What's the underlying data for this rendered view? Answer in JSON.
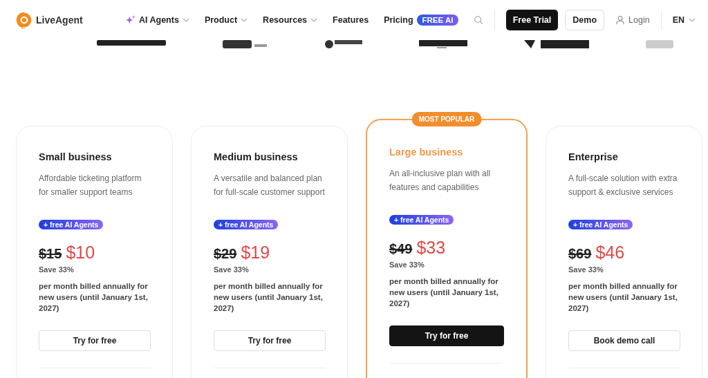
{
  "header": {
    "brand": "LiveAgent",
    "nav": [
      {
        "label": "AI Agents",
        "sparkle": true,
        "dropdown": true
      },
      {
        "label": "Product",
        "sparkle": false,
        "dropdown": true
      },
      {
        "label": "Resources",
        "sparkle": false,
        "dropdown": true
      },
      {
        "label": "Features",
        "sparkle": false,
        "dropdown": false
      },
      {
        "label": "Pricing",
        "sparkle": false,
        "dropdown": false,
        "badge": "FREE AI"
      }
    ],
    "primary_button": "Free Trial",
    "secondary_button": "Demo",
    "login": "Login",
    "language": "EN"
  },
  "plans": [
    {
      "name": "Small business",
      "featured": false,
      "description": "Affordable ticketing platform for smaller support teams",
      "tag": "+ free AI Agents",
      "old_price": "$15",
      "price": "$10",
      "save": "Save 33%",
      "note": "per month billed annually for new users (until January 1st, 2027)",
      "button": "Try for free"
    },
    {
      "name": "Medium business",
      "featured": false,
      "description": "A versatile and balanced plan for full-scale customer support",
      "tag": "+ free AI Agents",
      "old_price": "$29",
      "price": "$19",
      "save": "Save 33%",
      "note": "per month billed annually for new users (until January 1st, 2027)",
      "button": "Try for free"
    },
    {
      "name": "Large business",
      "featured": true,
      "badge": "MOST POPULAR",
      "description": "An all-inclusive plan with all features and capabilities",
      "tag": "+ free AI Agents",
      "old_price": "$49",
      "price": "$33",
      "save": "Save 33%",
      "note": "per month billed annually for new users (until January 1st, 2027)",
      "button": "Try for free"
    },
    {
      "name": "Enterprise",
      "featured": false,
      "description": "A full-scale solution with extra support & exclusive services",
      "tag": "+ free AI Agents",
      "old_price": "$69",
      "price": "$46",
      "save": "Save 33%",
      "note": "per month billed annually for new users (until January 1st, 2027)",
      "button": "Book demo call"
    }
  ]
}
